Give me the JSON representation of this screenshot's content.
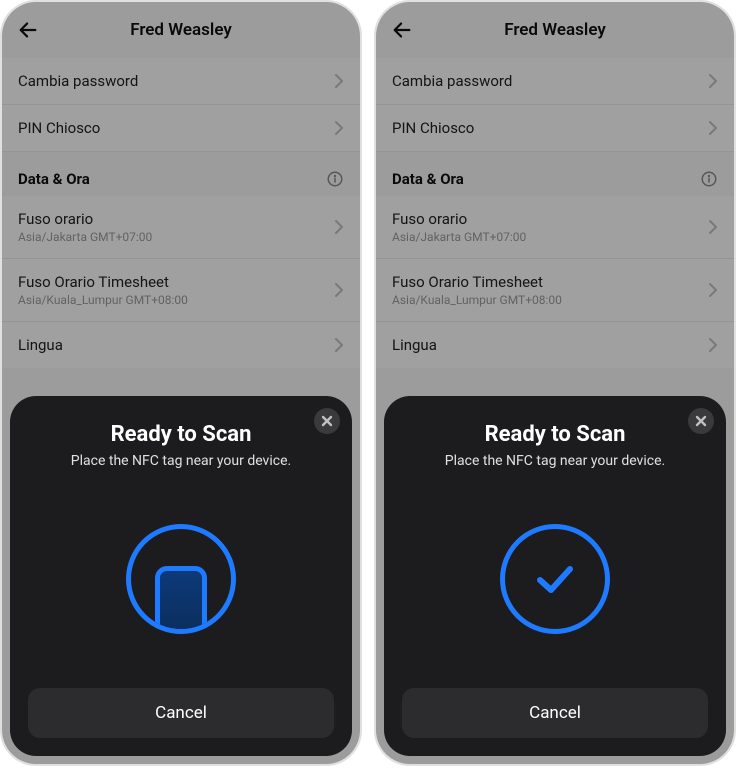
{
  "header": {
    "title": "Fred Weasley"
  },
  "rows": {
    "change_password": {
      "label": "Cambia password"
    },
    "kiosk_pin": {
      "label": "PIN Chiosco"
    },
    "timezone": {
      "label": "Fuso orario",
      "sub": "Asia/Jakarta GMT+07:00"
    },
    "timesheet_tz": {
      "label": "Fuso Orario Timesheet",
      "sub": "Asia/Kuala_Lumpur GMT+08:00"
    },
    "language": {
      "label": "Lingua"
    }
  },
  "sections": {
    "datetime": {
      "title": "Data & Ora"
    }
  },
  "sheet": {
    "title": "Ready to Scan",
    "subtitle": "Place the NFC tag near your device.",
    "cancel": "Cancel"
  }
}
